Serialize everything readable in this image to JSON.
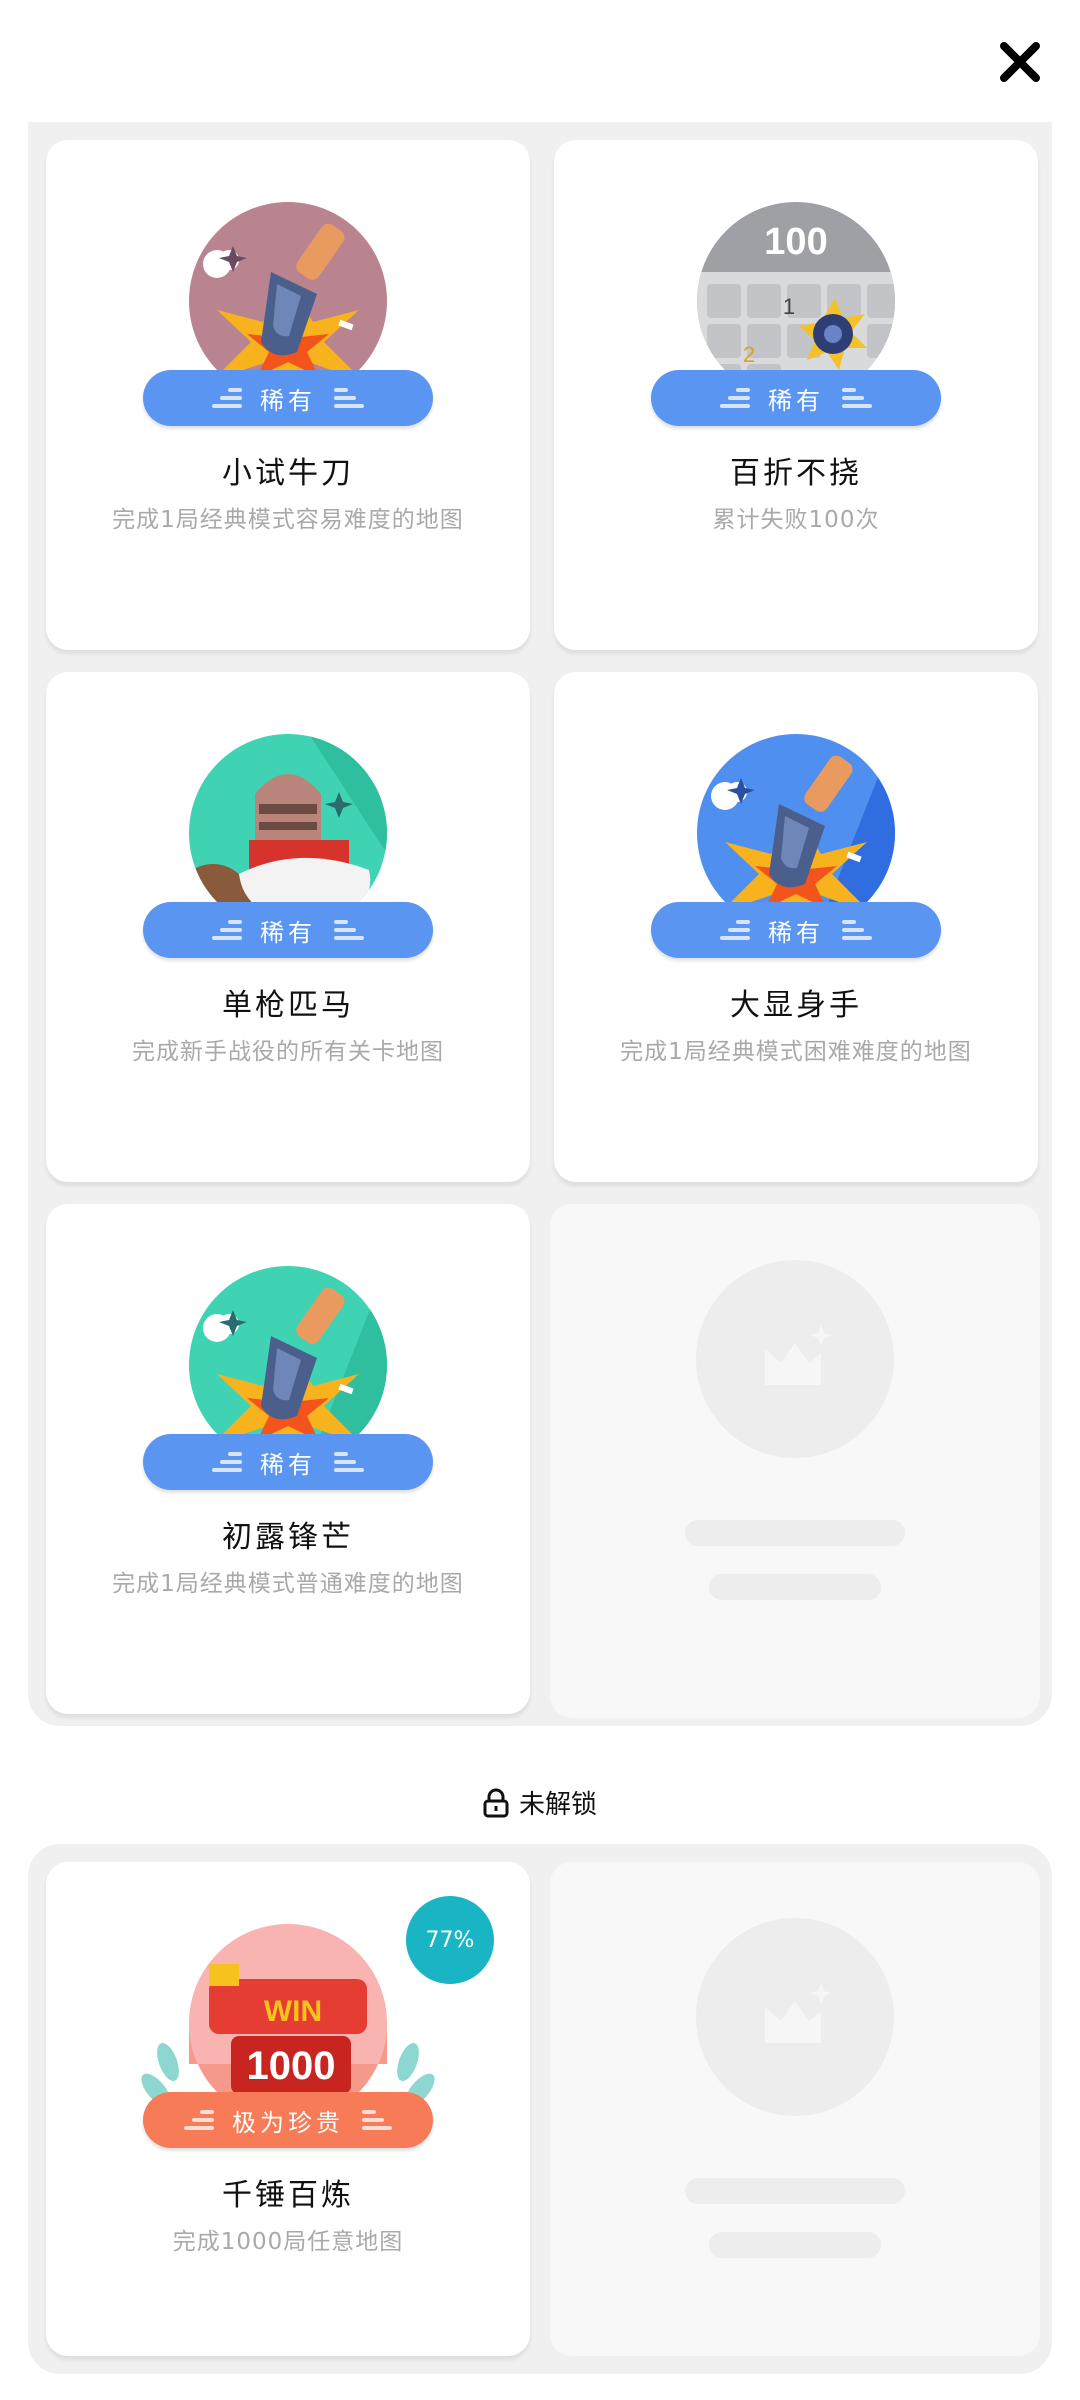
{
  "header": {
    "close_icon": "close-icon"
  },
  "unlocked": {
    "items": [
      {
        "badge_label": "稀有",
        "title": "小试牛刀",
        "desc": "完成1局经典模式容易难度的地图",
        "icon": "shovel-icon"
      },
      {
        "badge_label": "稀有",
        "title": "百折不挠",
        "desc": "累计失败100次",
        "icon": "mine-icon",
        "icon_number": "100",
        "tile_numbers": [
          "1",
          "2"
        ]
      },
      {
        "badge_label": "稀有",
        "title": "单枪匹马",
        "desc": "完成新手战役的所有关卡地图",
        "icon": "knight-icon"
      },
      {
        "badge_label": "稀有",
        "title": "大显身手",
        "desc": "完成1局经典模式困难难度的地图",
        "icon": "shovel-icon"
      },
      {
        "badge_label": "稀有",
        "title": "初露锋芒",
        "desc": "完成1局经典模式普通难度的地图",
        "icon": "shovel-icon"
      }
    ]
  },
  "locked_section": {
    "label": "未解锁",
    "items": [
      {
        "badge_label": "极为珍贵",
        "title": "千锤百炼",
        "desc": "完成1000局任意地图",
        "progress": "77%",
        "win_text": "WIN",
        "win_number": "1000",
        "icon": "trophy-icon"
      }
    ]
  },
  "colors": {
    "rare": "#5b95f2",
    "precious": "#f77b57",
    "progress": "#1ab5c4"
  }
}
